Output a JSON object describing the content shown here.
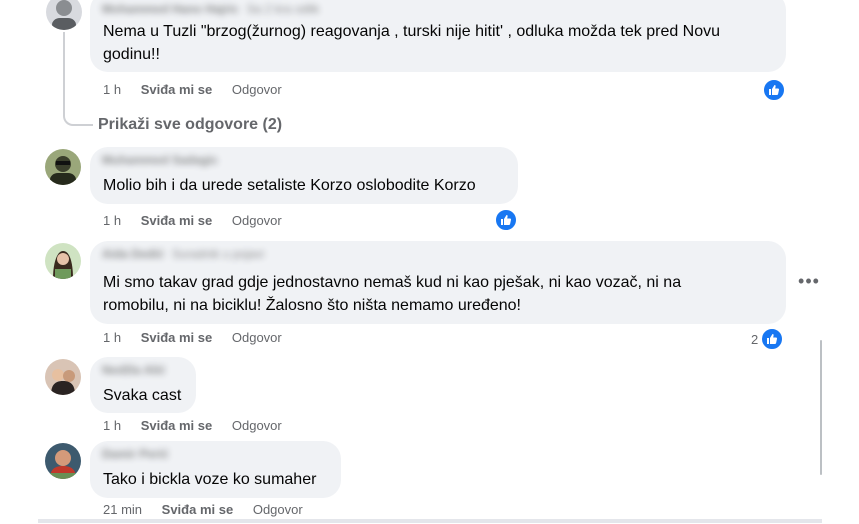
{
  "comments": [
    {
      "author": "Mohammed Hano Hajric",
      "author_meta": "Sa 2 kra odlik",
      "text_lines": [
        "Nema u Tuzli \"brzog(žurnog) reagovanja , turski nije hitit' , odluka možda tek pred Novu",
        "godinu!!"
      ],
      "time": "1 h",
      "like_label": "Sviđa mi se",
      "reply_label": "Odgovor",
      "reaction_count": "",
      "avatar_colors": [
        "#c9ccd1",
        "#6b6e72"
      ]
    },
    {
      "author": "Muhammed Sadagic",
      "author_meta": "",
      "text_lines": [
        "Molio bih i da urede setaliste Korzo oslobodite Korzo"
      ],
      "time": "1 h",
      "like_label": "Sviđa mi se",
      "reply_label": "Odgovor",
      "reaction_count": "",
      "avatar_colors": [
        "#7a8a5c",
        "#2d3320"
      ]
    },
    {
      "author": "Aida Dedić",
      "author_meta": "Suradnik u pojavi",
      "text_lines": [
        "Mi smo takav grad gdje jednostavno nemaš kud ni kao pješak, ni kao vozač, ni na",
        "romobilu, ni na biciklu! Žalosno što ništa nemamo uređeno!"
      ],
      "time": "1 h",
      "like_label": "Sviđa mi se",
      "reply_label": "Odgovor",
      "reaction_count": "2",
      "avatar_colors": [
        "#b8d4a8",
        "#4a6b3a"
      ]
    },
    {
      "author": "Nedžla Alić",
      "author_meta": "",
      "text_lines": [
        "Svaka cast"
      ],
      "time": "1 h",
      "like_label": "Sviđa mi se",
      "reply_label": "Odgovor",
      "reaction_count": "",
      "avatar_colors": [
        "#c9a58a",
        "#3a2a22"
      ]
    },
    {
      "author": "Damir Perić",
      "author_meta": "",
      "text_lines": [
        "Tako i bickla voze ko sumaher"
      ],
      "time": "21 min",
      "like_label": "Sviđa mi se",
      "reply_label": "Odgovor",
      "reaction_count": "",
      "avatar_colors": [
        "#d06a5a",
        "#2b3a4a"
      ]
    }
  ],
  "see_all_replies": "Prikaži sve odgovore (2)",
  "icons": {
    "like_reaction": "thumbs-up-icon",
    "more": "more-options-icon"
  },
  "colors": {
    "bubble": "#f0f2f5",
    "reaction": "#1877f2",
    "muted": "#65676b"
  }
}
